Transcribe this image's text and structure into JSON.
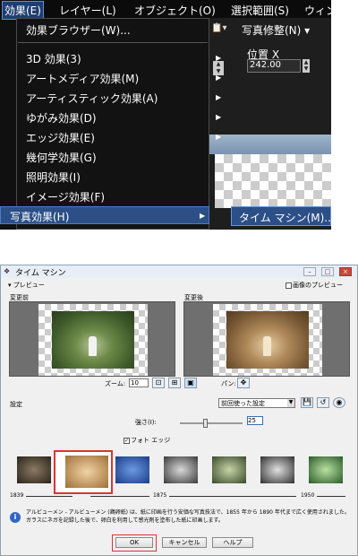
{
  "menu_bar": {
    "items": [
      "効果(E)",
      "レイヤー(L)",
      "オブジェクト(O)",
      "選択範囲(S)",
      "ウィン"
    ]
  },
  "effects_menu": {
    "items": [
      {
        "label": "効果ブラウザー(W)...",
        "arrow": false
      },
      {
        "label": "3D 効果(3)",
        "arrow": true
      },
      {
        "label": "アートメディア効果(M)",
        "arrow": true
      },
      {
        "label": "アーティスティック効果(A)",
        "arrow": true
      },
      {
        "label": "ゆがみ効果(D)",
        "arrow": true
      },
      {
        "label": "エッジ効果(E)",
        "arrow": true
      },
      {
        "label": "幾何学効果(G)",
        "arrow": true
      },
      {
        "label": "照明効果(I)",
        "arrow": true
      },
      {
        "label": "イメージ効果(F)",
        "arrow": true
      },
      {
        "label": "写真効果(H)",
        "arrow": true
      }
    ],
    "submenu_item": "タイム マシン(M)..."
  },
  "toolbar": {
    "photo_fix": "写真修整(N)",
    "position_label": "位置 X",
    "position_x": "242.00"
  },
  "dialog": {
    "title": "タイム マシン",
    "preview_toggle": "プレビュー",
    "full_preview": "画像のプレビュー",
    "before_label": "変更前",
    "after_label": "変更後",
    "zoom_label": "ズーム:",
    "zoom_value": "10",
    "pan_label": "パン:",
    "settings_label": "設定",
    "preset": "前回使った設定",
    "strength_label": "強さ(I):",
    "strength_value": "25",
    "photo_edge_label": "フォト エッジ",
    "photo_edge_checked": true,
    "timeline": [
      "1839",
      "1875",
      "1950"
    ],
    "info": "アルビューメン - アルビューメン (鶏卵紙) は、紙に印画を行う安価な写真技法で、1855 年から 1890 年代まで広く使用されました。ガラスにネガを記録した後で、卵白を利用して感光剤を塗布した紙に印画します。",
    "buttons": {
      "ok": "OK",
      "cancel": "キャンセル",
      "help": "ヘルプ"
    }
  },
  "colors": {
    "highlight": "#2b4f86",
    "annotation_red": "#d33333"
  }
}
